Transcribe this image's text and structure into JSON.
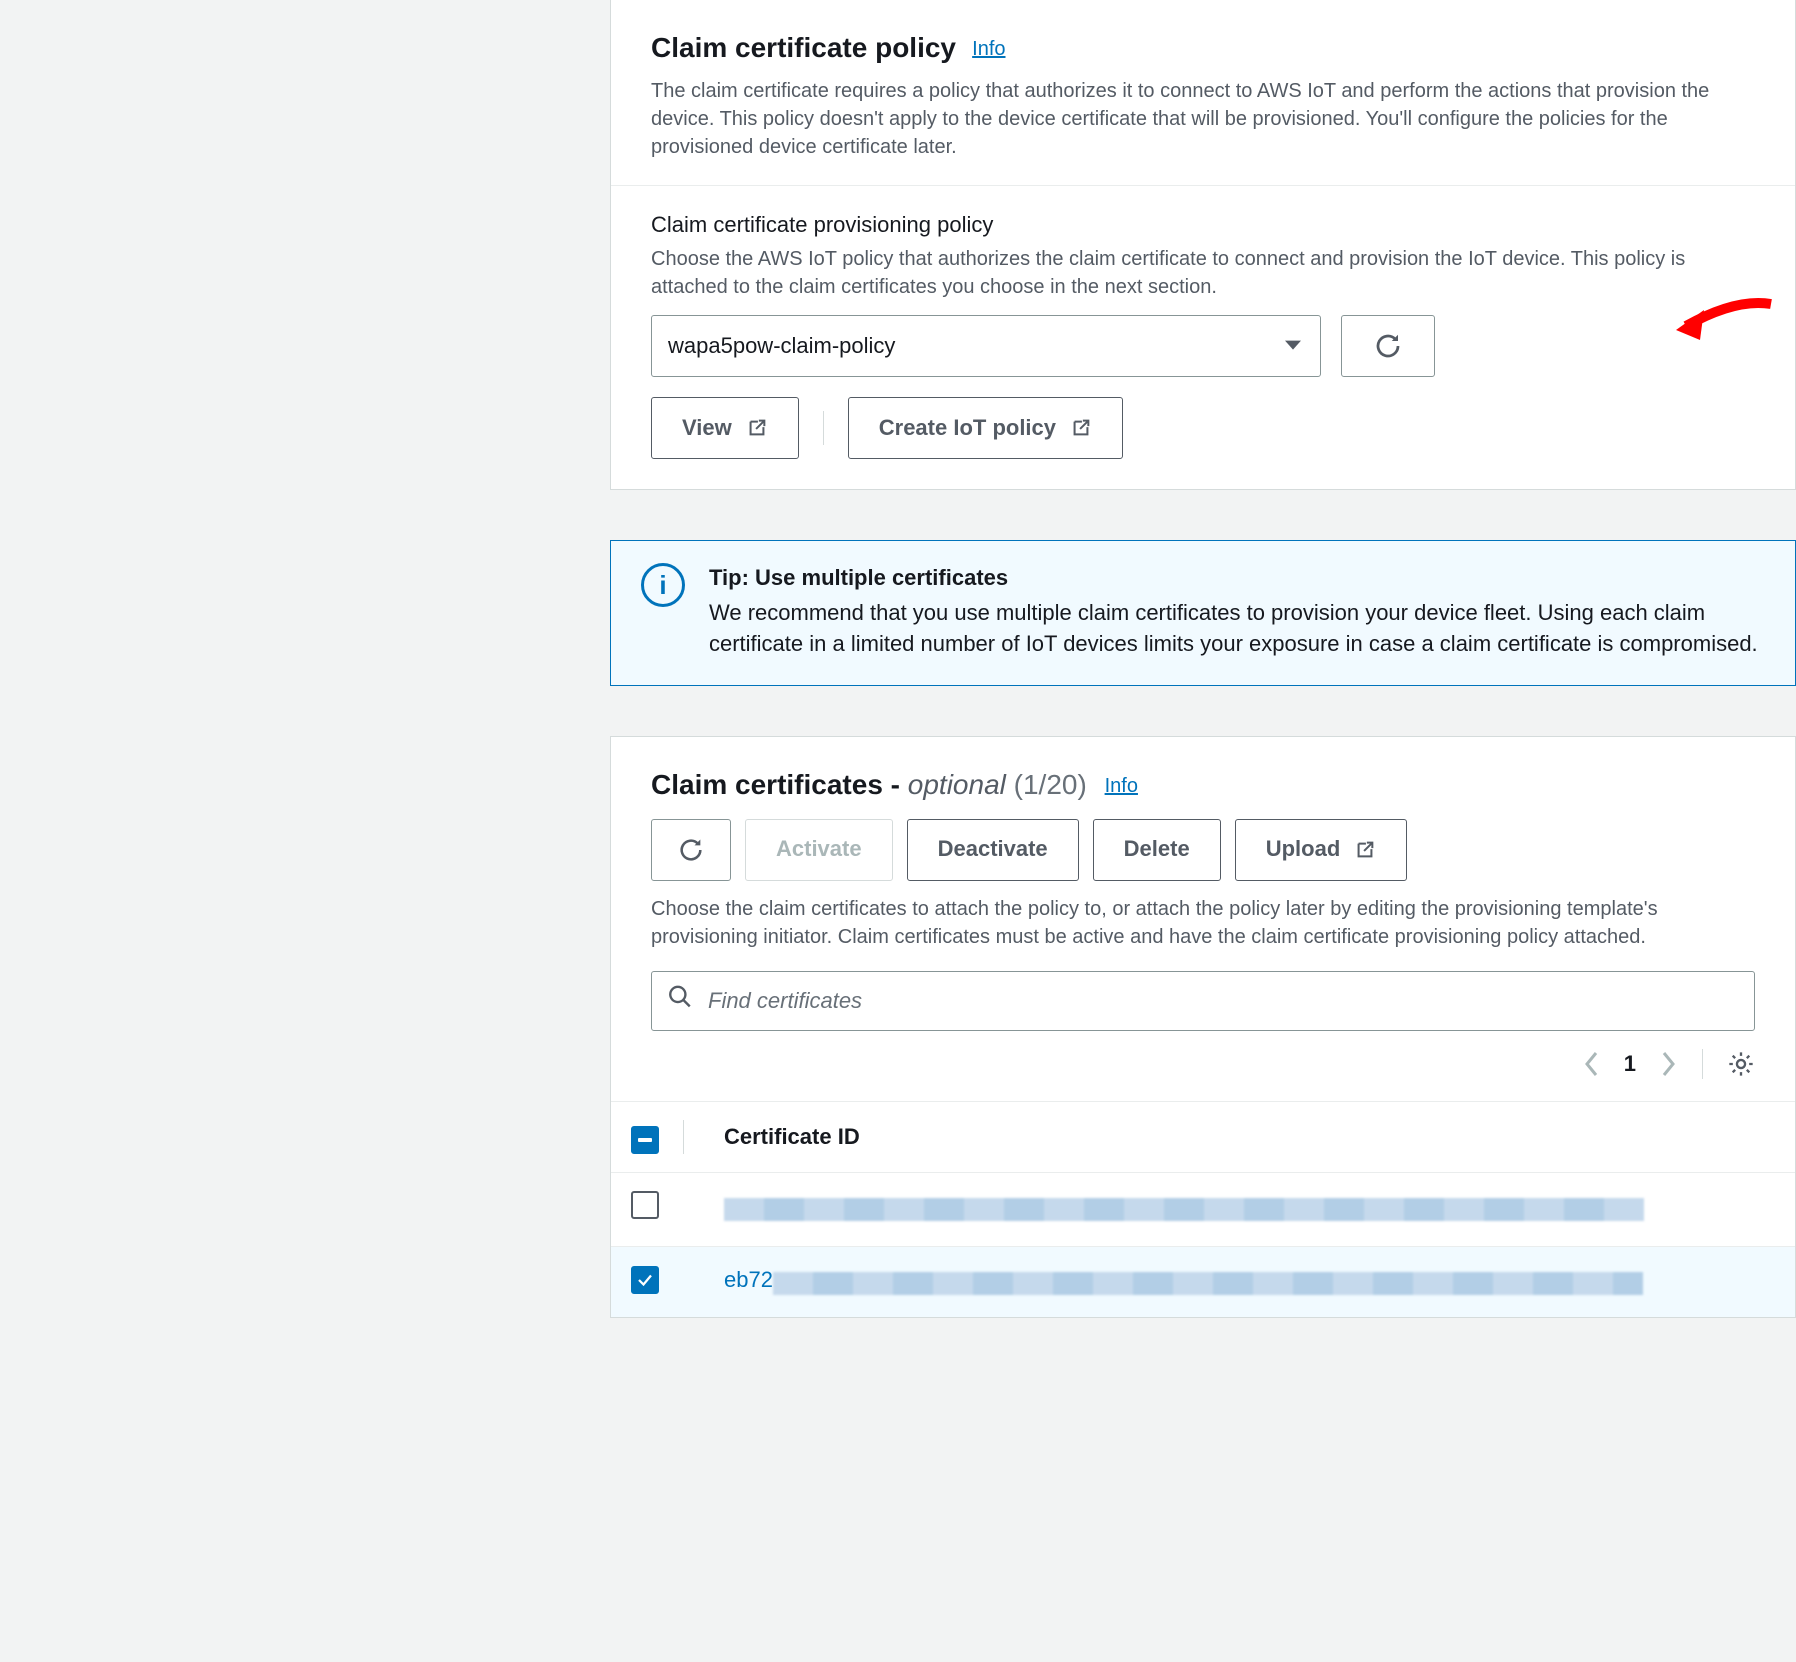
{
  "policy_section": {
    "title": "Claim certificate policy",
    "info": "Info",
    "desc": "The claim certificate requires a policy that authorizes it to connect to AWS IoT and perform the actions that provision the device. This policy doesn't apply to the device certificate that will be provisioned. You'll configure the policies for the provisioned device certificate later.",
    "form_label": "Claim certificate provisioning policy",
    "form_hint": "Choose the AWS IoT policy that authorizes the claim certificate to connect and provision the IoT device. This policy is attached to the claim certificates you choose in the next section.",
    "selected_policy": "wapa5pow-claim-policy",
    "view_btn": "View",
    "create_btn": "Create IoT policy"
  },
  "tip": {
    "title": "Tip: Use multiple certificates",
    "body": "We recommend that you use multiple claim certificates to provision your device fleet. Using each claim certificate in a limited number of IoT devices limits your exposure in case a claim certificate is compromised."
  },
  "certs": {
    "title_main": "Claim certificates -",
    "title_optional": "optional",
    "count_text": "(1/20)",
    "info": "Info",
    "toolbar": {
      "activate": "Activate",
      "deactivate": "Deactivate",
      "delete": "Delete",
      "upload": "Upload"
    },
    "desc": "Choose the claim certificates to attach the policy to, or attach the policy later by editing the provisioning template's provisioning initiator. Claim certificates must be active and have the claim certificate provisioning policy attached.",
    "search_placeholder": "Find certificates",
    "page": "1",
    "header_col": "Certificate ID",
    "rows": [
      {
        "selected": false,
        "prefix": ""
      },
      {
        "selected": true,
        "prefix": "eb72"
      }
    ]
  }
}
